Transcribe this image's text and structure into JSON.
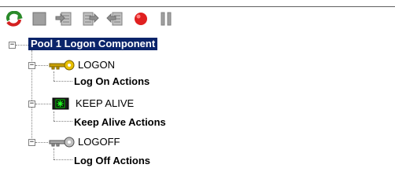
{
  "toolbar": {
    "buttons": [
      {
        "name": "refresh-icon",
        "color": "#d42020"
      },
      {
        "name": "stop-square-icon",
        "color": "#909090"
      },
      {
        "name": "step-in-icon",
        "color": "#909090"
      },
      {
        "name": "step-over-icon",
        "color": "#909090"
      },
      {
        "name": "step-back-icon",
        "color": "#909090"
      },
      {
        "name": "record-icon",
        "color": "#e02020"
      },
      {
        "name": "pause-icon",
        "color": "#909090"
      }
    ]
  },
  "tree": {
    "root": {
      "label": "Pool 1 Logon Component",
      "expander": "−"
    },
    "nodes": [
      {
        "label": "LOGON",
        "icon": "key-icon",
        "child": "Log On Actions",
        "expander": "−"
      },
      {
        "label": "KEEP ALIVE",
        "icon": "keepalive-icon",
        "child": "Keep Alive Actions",
        "expander": "−"
      },
      {
        "label": "LOGOFF",
        "icon": "key-gray-icon",
        "child": "Log Off Actions",
        "expander": "−"
      }
    ]
  },
  "colors": {
    "selection": "#0a246a",
    "tree_lines": "#808080",
    "key_gold": "#c8a000",
    "record_red": "#e02020"
  }
}
